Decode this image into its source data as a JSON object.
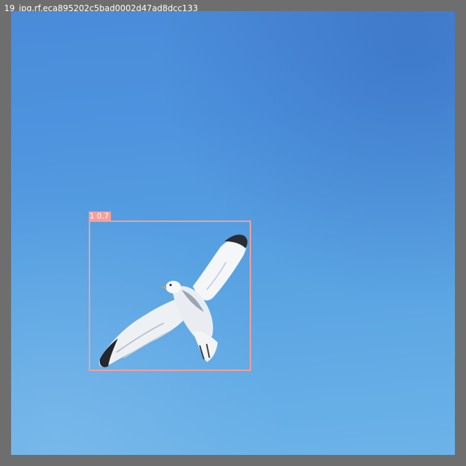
{
  "window": {
    "title": "19_jpg.rf.eca895202c5bad0002d47ad8dcc133"
  },
  "image": {
    "subject_icon": "seagull-icon",
    "sky_color": "#4f95dc"
  },
  "detections": [
    {
      "label": "1 0.7",
      "color": "#f4a09a"
    }
  ]
}
